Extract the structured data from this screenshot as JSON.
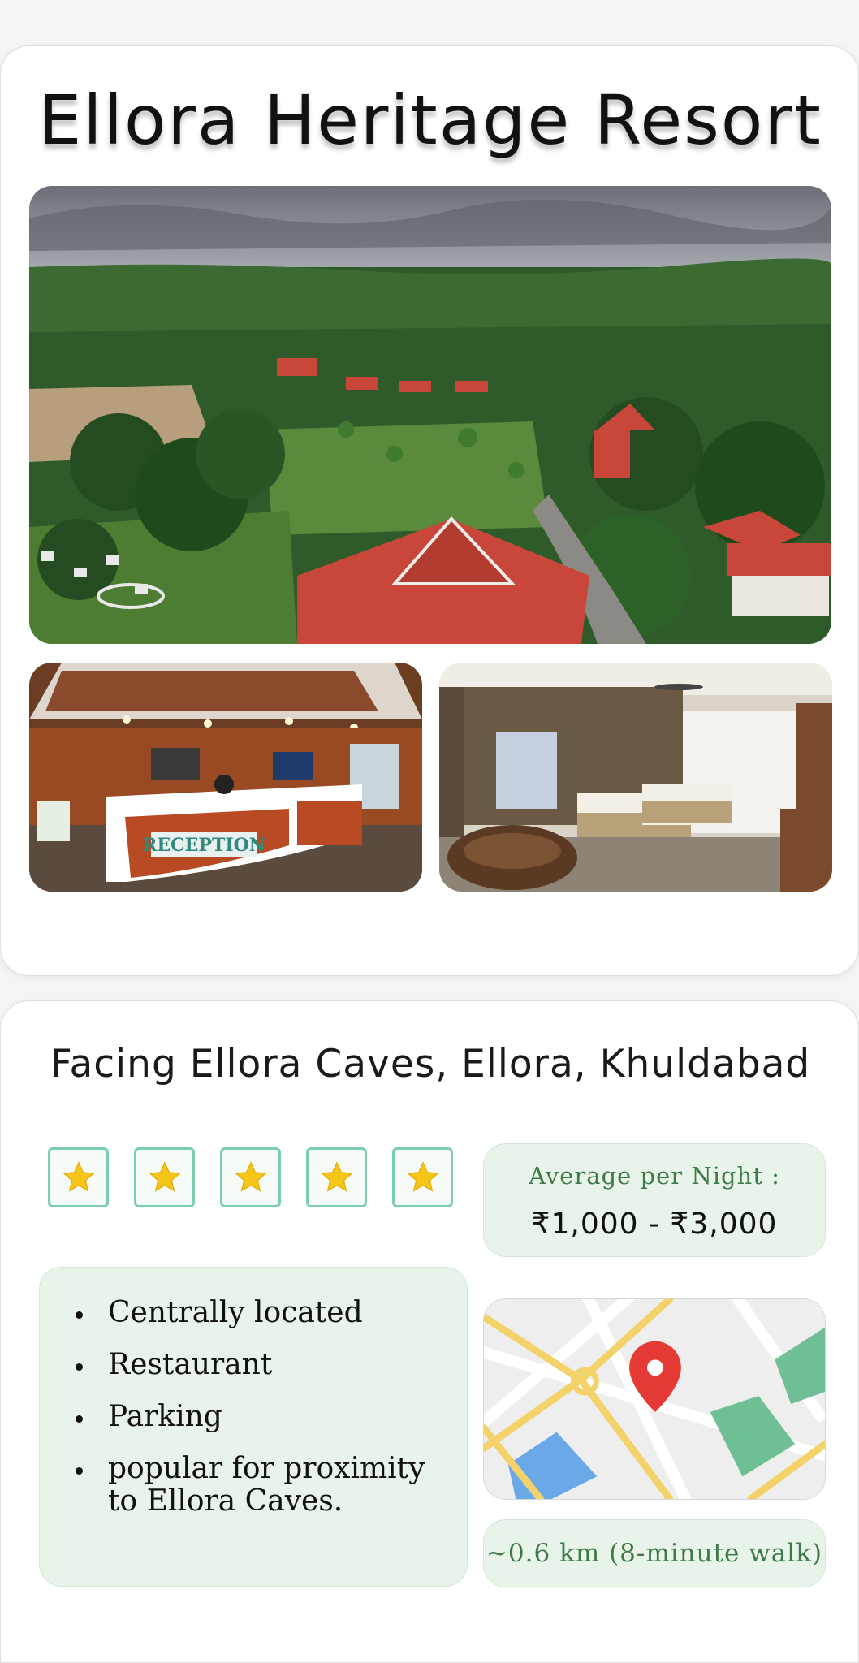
{
  "header": {
    "title": "Ellora Heritage Resort"
  },
  "photos": {
    "main": "aerial-view-photo",
    "reception": "reception-lobby-photo",
    "room": "guest-room-photo",
    "reception_sign": "RECEPTION"
  },
  "details": {
    "address": "Facing Ellora Caves, Ellora, Khuldabad",
    "rating": {
      "stars": 5,
      "icon": "star-icon"
    },
    "price": {
      "label": "Average per Night :",
      "value": "₹1,000 - ₹3,000"
    },
    "amenities": [
      "Centrally located",
      "Restaurant",
      "Parking",
      "popular for proximity to Ellora Caves."
    ],
    "map_icon": "location-pin-icon",
    "distance": "~0.6 km (8-minute walk)"
  },
  "colors": {
    "accent_green": "#3d7b46",
    "panel_green": "#e8f4e9",
    "star_border": "#7bcfb0",
    "star_fill": "#f5c518",
    "pin_red": "#e53935",
    "roof_red": "#c9473a"
  }
}
